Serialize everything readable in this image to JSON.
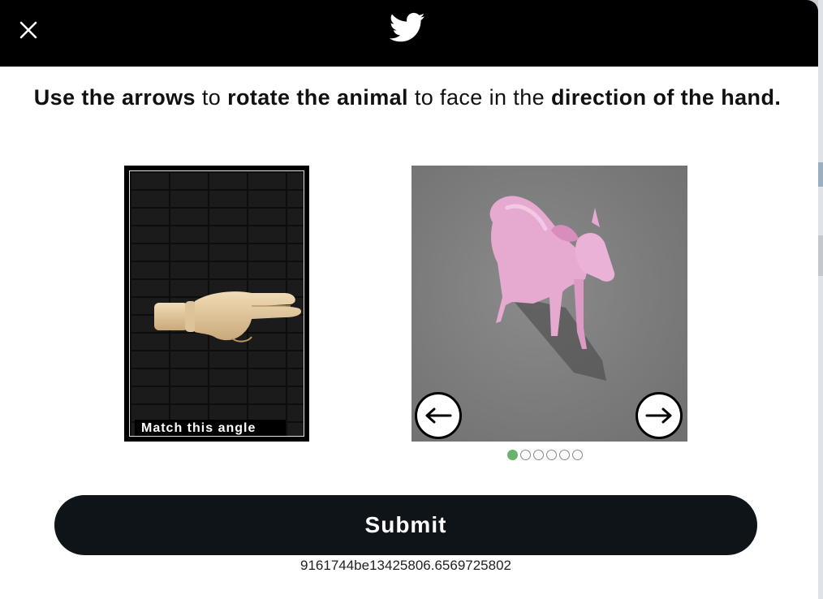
{
  "header": {
    "close_icon": "close-icon",
    "logo_icon": "twitter-bird-icon",
    "colors": {
      "bar": "#000000"
    }
  },
  "prompt": {
    "part1": "Use the arrows",
    "part2": " to ",
    "part3": "rotate the animal",
    "part4": " to face in the ",
    "part5": "direction of the hand."
  },
  "reference": {
    "label": "Match this angle",
    "image": "pointing-hand"
  },
  "challenge": {
    "image": "pink-deer-3d",
    "left_icon": "arrow-left-icon",
    "right_icon": "arrow-right-icon",
    "step_total": 6,
    "step_current": 1,
    "colors": {
      "active_dot": "#6bb36b"
    }
  },
  "submit": {
    "label": "Submit"
  },
  "footer": {
    "session_id": "9161744be13425806.6569725802"
  }
}
